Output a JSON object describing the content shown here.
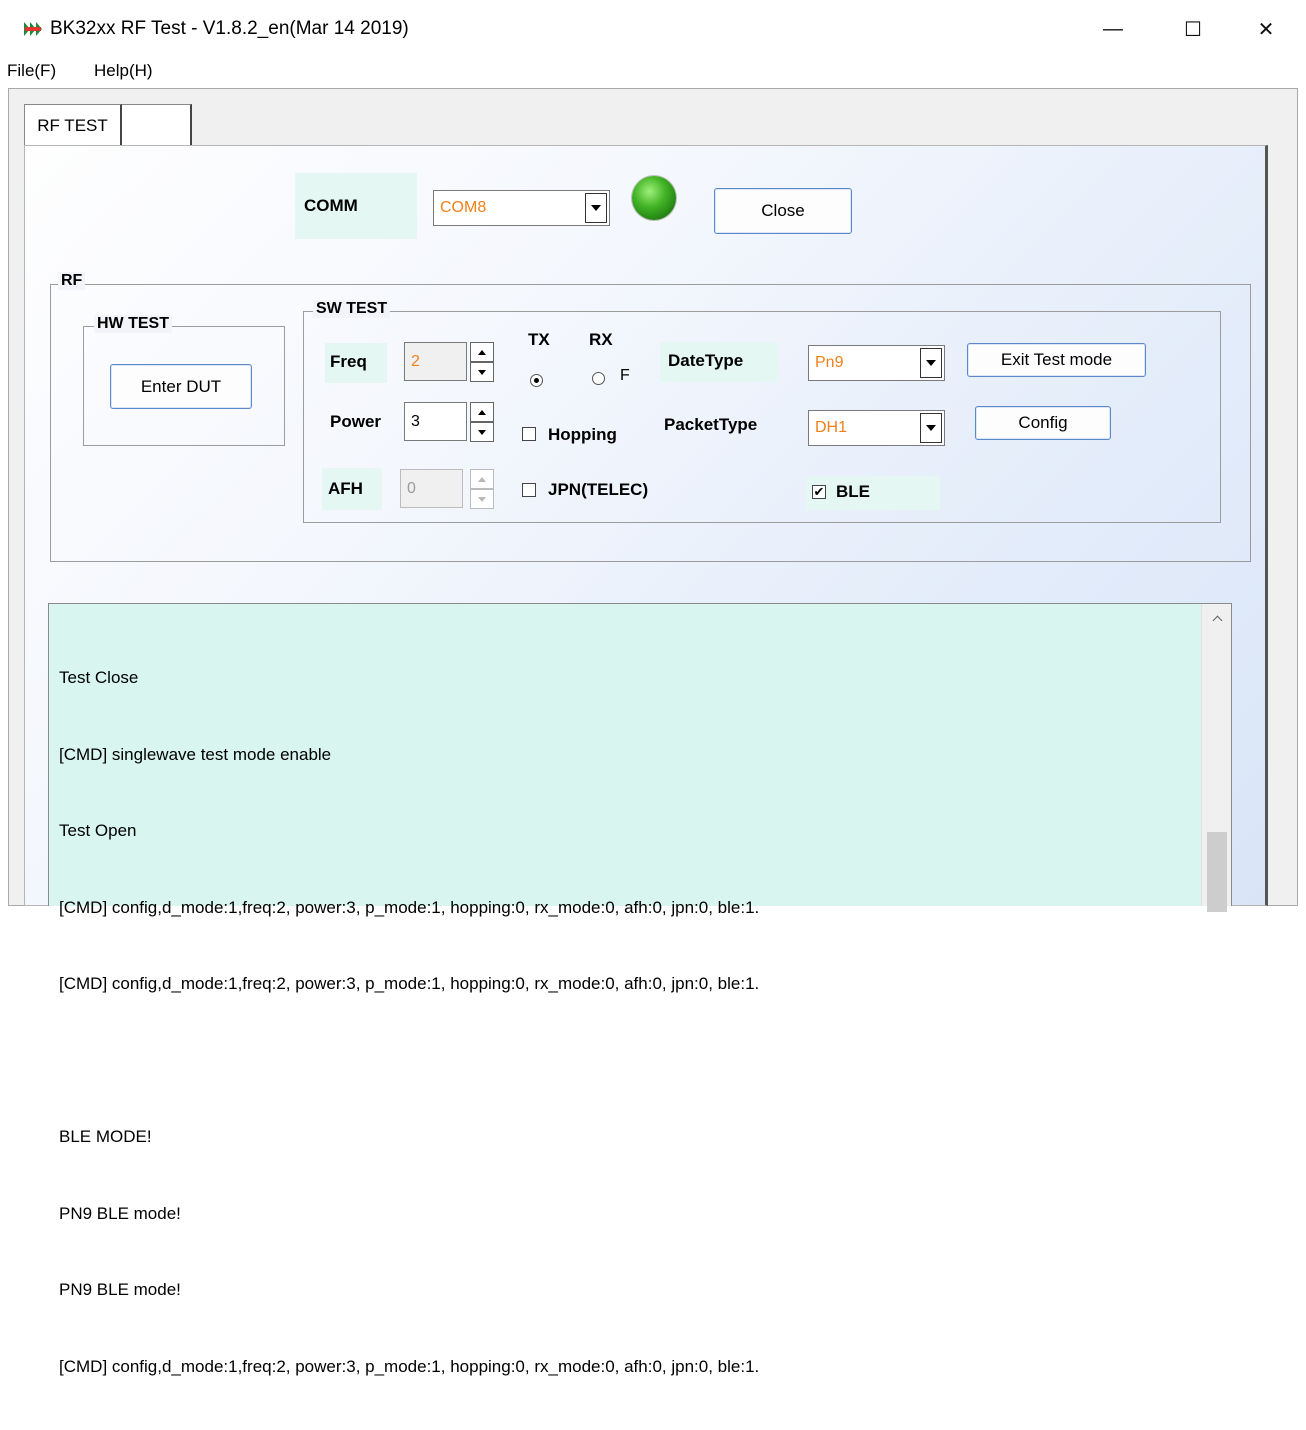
{
  "window": {
    "title": "BK32xx RF Test - V1.8.2_en(Mar 14 2019)",
    "minimize_glyph": "—",
    "maximize_glyph": "☐",
    "close_glyph": "✕"
  },
  "menu": {
    "items": [
      "File(F)",
      "Help(H)"
    ]
  },
  "tabs": [
    {
      "label": "RF TEST",
      "active": true
    },
    {
      "label": "",
      "active": false
    }
  ],
  "comm": {
    "label": "COMM",
    "port_value": "COM8",
    "status_led": {
      "color": "#43b426",
      "state": "connected"
    },
    "close_button": "Close"
  },
  "rf_group": {
    "title": "RF"
  },
  "hw_test": {
    "title": "HW TEST",
    "enter_dut_button": "Enter DUT"
  },
  "sw_test": {
    "title": "SW TEST",
    "freq": {
      "label": "Freq",
      "value": "2"
    },
    "power": {
      "label": "Power",
      "value": "3"
    },
    "afh": {
      "label": "AFH",
      "value": "0"
    },
    "tx": {
      "label": "TX",
      "selected": true
    },
    "rx": {
      "label": "RX",
      "selected": false,
      "option_text": "F"
    },
    "hopping": {
      "label": "Hopping",
      "checked": false
    },
    "jpn": {
      "label": "JPN(TELEC)",
      "checked": false
    },
    "date_type": {
      "label": "DateType",
      "value": "Pn9"
    },
    "packet_type": {
      "label": "PacketType",
      "value": "DH1"
    },
    "ble": {
      "label": "BLE",
      "checked": true,
      "mark": "✔"
    },
    "exit_test_mode_button": "Exit Test mode",
    "config_button": "Config"
  },
  "log": {
    "lines": [
      "Test Close",
      "[CMD] singlewave test mode enable",
      "Test Open",
      "[CMD] config,d_mode:1,freq:2, power:3, p_mode:1, hopping:0, rx_mode:0, afh:0, jpn:0, ble:1.",
      "[CMD] config,d_mode:1,freq:2, power:3, p_mode:1, hopping:0, rx_mode:0, afh:0, jpn:0, ble:1.",
      "",
      "BLE MODE!",
      "PN9 BLE mode!",
      "PN9 BLE mode!",
      "[CMD] config,d_mode:1,freq:2, power:3, p_mode:1, hopping:0, rx_mode:0, afh:0, jpn:0, ble:1."
    ]
  },
  "colors": {
    "combo_text": "#f08019",
    "label_bg": "#e4f7f2",
    "log_bg": "#d8f6ef",
    "button_border": "#5b88c9"
  }
}
